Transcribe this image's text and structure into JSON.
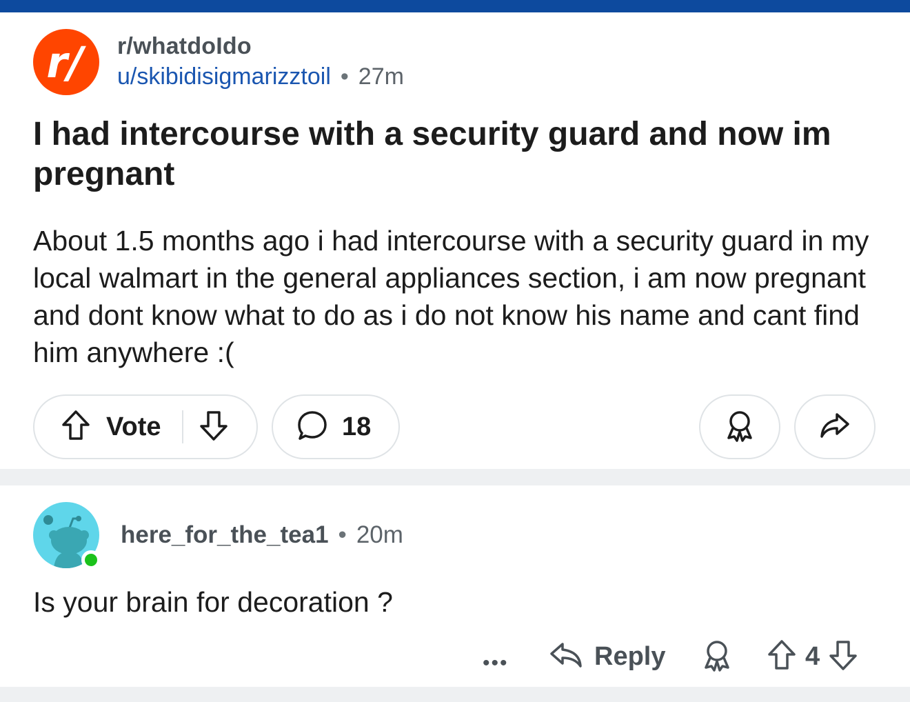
{
  "colors": {
    "top_bar": "#0d4a9e",
    "subreddit_icon_bg": "#ff4500",
    "username_link": "#1a56b0",
    "avatar_bg": "#5fd6ea",
    "online_dot": "#1bc21b",
    "divider": "#eef0f2"
  },
  "post": {
    "subreddit": "r/whatdoIdo",
    "author": "u/skibidisigmarizztoil",
    "separator": "•",
    "age": "27m",
    "title": "I had intercourse with a security guard and now im pregnant",
    "body": "About 1.5 months ago i had intercourse with a security guard in my local walmart in the general appliances section, i am now pregnant and dont know what to do as i do not know his name and cant find him anywhere :(",
    "actions": {
      "vote_label": "Vote",
      "comment_count": "18",
      "icons": {
        "upvote": "arrow-up-icon",
        "downvote": "arrow-down-icon",
        "comments": "speech-bubble-icon",
        "award": "award-ribbon-icon",
        "share": "share-arrow-icon"
      }
    }
  },
  "comment": {
    "author": "here_for_the_tea1",
    "separator": "•",
    "age": "20m",
    "text": "Is your brain for decoration ?",
    "actions": {
      "more": "•••",
      "reply_label": "Reply",
      "score": "4",
      "icons": {
        "more": "more-dots-icon",
        "reply": "reply-arrow-icon",
        "award": "award-ribbon-icon",
        "upvote": "arrow-up-icon",
        "downvote": "arrow-down-icon"
      }
    }
  }
}
